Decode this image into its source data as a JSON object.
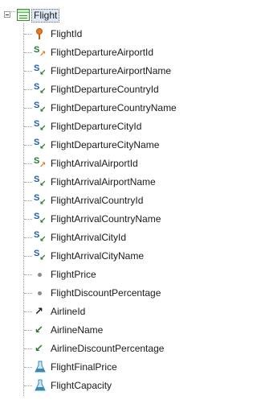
{
  "root": {
    "label": "Flight",
    "icon": "transaction-table-icon"
  },
  "colors": {
    "key": "#e87a1e",
    "subtype_green": "#1f7a2a",
    "subtype_blue": "#1f5fa8",
    "dot": "#8a8a8a",
    "inferred_arrow": "#2a7a2a",
    "formula": "#3a8ab5",
    "selection_bg": "#dfe9f6"
  },
  "items": [
    {
      "label": "FlightId",
      "icon": "primary-key-icon"
    },
    {
      "label": "FlightDepartureAirportId",
      "icon": "subtype-key-icon"
    },
    {
      "label": "FlightDepartureAirportName",
      "icon": "subtype-inferred-icon"
    },
    {
      "label": "FlightDepartureCountryId",
      "icon": "subtype-inferred-icon"
    },
    {
      "label": "FlightDepartureCountryName",
      "icon": "subtype-inferred-icon"
    },
    {
      "label": "FlightDepartureCityId",
      "icon": "subtype-inferred-icon"
    },
    {
      "label": "FlightDepartureCityName",
      "icon": "subtype-inferred-icon"
    },
    {
      "label": "FlightArrivalAirportId",
      "icon": "subtype-key-icon"
    },
    {
      "label": "FlightArrivalAirportName",
      "icon": "subtype-inferred-icon"
    },
    {
      "label": "FlightArrivalCountryId",
      "icon": "subtype-inferred-icon"
    },
    {
      "label": "FlightArrivalCountryName",
      "icon": "subtype-inferred-icon"
    },
    {
      "label": "FlightArrivalCityId",
      "icon": "subtype-inferred-icon"
    },
    {
      "label": "FlightArrivalCityName",
      "icon": "subtype-inferred-icon"
    },
    {
      "label": "FlightPrice",
      "icon": "attribute-dot-icon"
    },
    {
      "label": "FlightDiscountPercentage",
      "icon": "attribute-dot-icon"
    },
    {
      "label": "AirlineId",
      "icon": "foreign-key-arrow-icon"
    },
    {
      "label": "AirlineName",
      "icon": "inferred-arrow-icon"
    },
    {
      "label": "AirlineDiscountPercentage",
      "icon": "inferred-arrow-icon"
    },
    {
      "label": "FlightFinalPrice",
      "icon": "formula-flask-icon"
    },
    {
      "label": "FlightCapacity",
      "icon": "formula-flask-icon"
    }
  ]
}
